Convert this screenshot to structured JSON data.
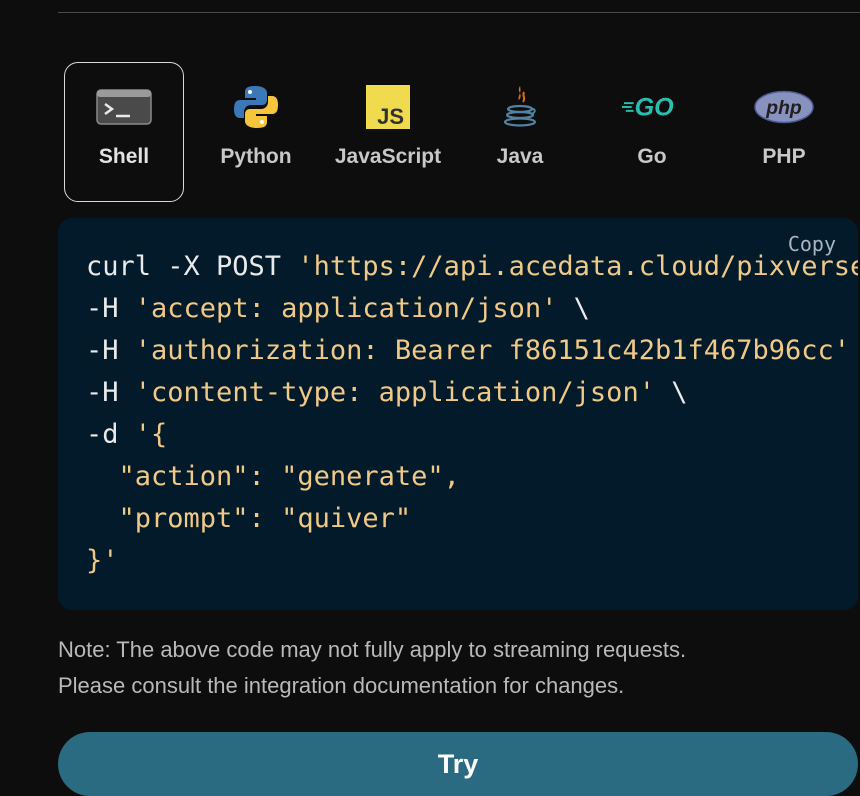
{
  "language_tabs": [
    {
      "label": "Shell",
      "icon": "terminal-icon",
      "active": true
    },
    {
      "label": "Python",
      "icon": "python-icon",
      "active": false
    },
    {
      "label": "JavaScript",
      "icon": "javascript-icon",
      "active": false
    },
    {
      "label": "Java",
      "icon": "java-icon",
      "active": false
    },
    {
      "label": "Go",
      "icon": "go-icon",
      "active": false
    },
    {
      "label": "PHP",
      "icon": "php-icon",
      "active": false
    }
  ],
  "icon_text": {
    "js": "JS",
    "go": "GO",
    "php": "php"
  },
  "code_panel": {
    "copy_label": "Copy",
    "lines": [
      {
        "plain": "curl -X POST ",
        "str": "'https://api.acedata.cloud/pixverse/videos'",
        "tail": " \\"
      },
      {
        "plain": "-H ",
        "str": "'accept: application/json'",
        "tail": " \\"
      },
      {
        "plain": "-H ",
        "str": "'authorization: Bearer f86151c42b1f467b96cc'",
        "tail": " \\"
      },
      {
        "plain": "-H ",
        "str": "'content-type: application/json'",
        "tail": " \\"
      },
      {
        "plain": "-d ",
        "str": "'{",
        "tail": ""
      },
      {
        "plain": "  ",
        "str": "\"action\": \"generate\",",
        "tail": ""
      },
      {
        "plain": "  ",
        "str": "\"prompt\": \"quiver\"",
        "tail": ""
      },
      {
        "plain": "",
        "str": "}'",
        "tail": ""
      }
    ]
  },
  "note": {
    "line1": "Note: The above code may not fully apply to streaming requests.",
    "line2": "Please consult the integration documentation for changes."
  },
  "try_button": {
    "label": "Try"
  },
  "colors": {
    "background": "#0d0d0d",
    "code_background": "#021a2a",
    "string": "#f0c987",
    "try_button": "#2a6b82",
    "js_yellow": "#f0db4f",
    "go_teal": "#29beb0",
    "php_purple": "#8892bf"
  }
}
